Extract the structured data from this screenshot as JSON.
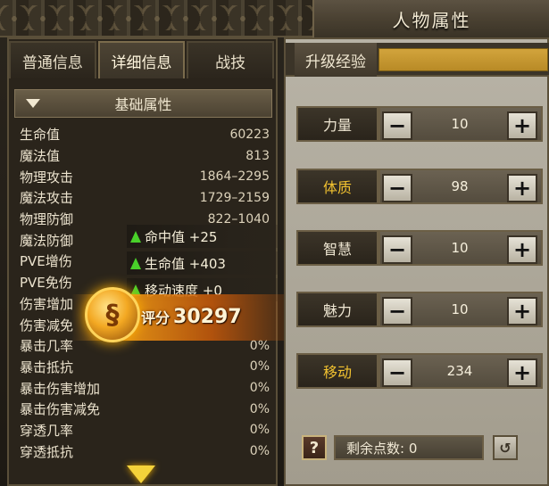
{
  "window": {
    "title": "人物属性"
  },
  "tabs": [
    {
      "label": "普通信息",
      "active": false
    },
    {
      "label": "详细信息",
      "active": true
    },
    {
      "label": "战技",
      "active": false
    }
  ],
  "section": {
    "title": "基础属性"
  },
  "stats": [
    {
      "name": "生命值",
      "value": "60223"
    },
    {
      "name": "魔法值",
      "value": "813"
    },
    {
      "name": "物理攻击",
      "value": "1864–2295"
    },
    {
      "name": "魔法攻击",
      "value": "1729–2159"
    },
    {
      "name": "物理防御",
      "value": "822–1040"
    },
    {
      "name": "魔法防御",
      "value": ""
    },
    {
      "name": "PVE增伤",
      "value": ""
    },
    {
      "name": "PVE免伤",
      "value": ""
    },
    {
      "name": "伤害增加",
      "value": ""
    },
    {
      "name": "伤害减免",
      "value": ""
    },
    {
      "name": "暴击几率",
      "value": "0%"
    },
    {
      "name": "暴击抵抗",
      "value": "0%"
    },
    {
      "name": "暴击伤害增加",
      "value": "0%"
    },
    {
      "name": "暴击伤害减免",
      "value": "0%"
    },
    {
      "name": "穿透几率",
      "value": "0%"
    },
    {
      "name": "穿透抵抗",
      "value": "0%"
    }
  ],
  "popup": {
    "lines": [
      {
        "text": "命中值 +25"
      },
      {
        "text": "生命值 +403"
      },
      {
        "text": "移动速度 +0"
      }
    ],
    "score_label": "评分",
    "score_value": "30297"
  },
  "experience": {
    "label": "升级经验"
  },
  "attributes": [
    {
      "name": "力量",
      "value": "10",
      "highlight": false
    },
    {
      "name": "体质",
      "value": "98",
      "highlight": true
    },
    {
      "name": "智慧",
      "value": "10",
      "highlight": false
    },
    {
      "name": "魅力",
      "value": "10",
      "highlight": false
    },
    {
      "name": "移动",
      "value": "234",
      "highlight": true
    }
  ],
  "buttons": {
    "minus": "−",
    "plus": "+",
    "help": "?",
    "reset": "↺"
  },
  "points": {
    "text": "剩余点数: 0"
  },
  "colors": {
    "gold": "#f2c230",
    "exp_fill": "#c99a30",
    "green_arrow": "#49d12a"
  }
}
